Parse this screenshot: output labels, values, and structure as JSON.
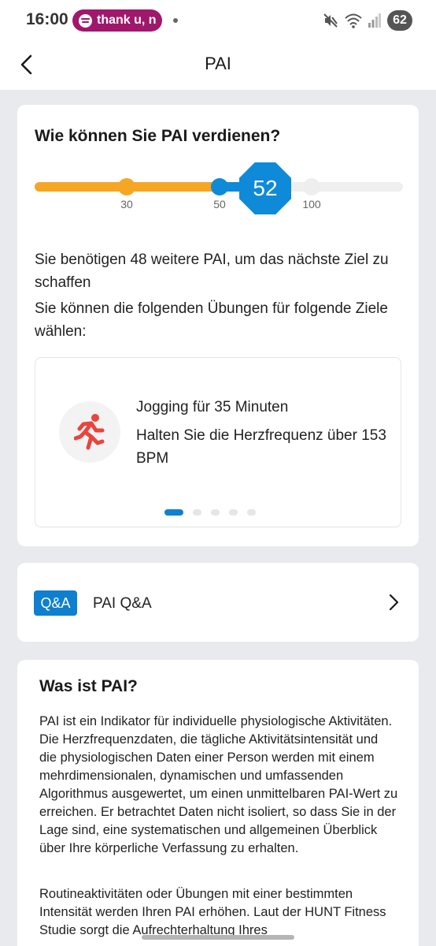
{
  "status_bar": {
    "time": "16:00",
    "media_title": "thank u, n",
    "battery": "62"
  },
  "header": {
    "title": "PAI"
  },
  "earn_card": {
    "title": "Wie können Sie PAI verdienen?",
    "progress": {
      "ticks": [
        "30",
        "50",
        "100"
      ],
      "current": "52",
      "value": 52,
      "max": 100
    },
    "needed_text": "Sie benötigen 48 weitere PAI, um das nächste Ziel zu schaffen",
    "choose_text": "Sie können die folgenden Übungen für folgende Ziele wählen:",
    "exercise": {
      "icon": "running-person-icon",
      "line1": "Jogging für 35 Minuten",
      "line2": "Halten Sie die Herzfrequenz über 153 BPM"
    },
    "carousel": {
      "total": 5,
      "active": 1
    }
  },
  "qa": {
    "badge": "Q&A",
    "label": "PAI Q&A"
  },
  "what_card": {
    "title": "Was ist PAI?",
    "paragraph1": "PAI ist ein Indikator für individuelle physiologische Aktivitäten. Die Herzfrequenzdaten, die tägliche Aktivitätsintensität und die physiologischen Daten einer Person werden mit einem mehrdimensionalen, dynamischen und umfassenden Algorithmus ausgewertet, um einen unmittelbaren PAI-Wert zu erreichen. Er betrachtet Daten nicht isoliert, so dass Sie in der Lage sind, eine systematischen und allgemeinen Überblick über Ihre körperliche Verfassung zu erhalten.",
    "paragraph2": "Routineaktivitäten oder Übungen mit einer bestimmten Intensität werden Ihren PAI erhöhen. Laut der HUNT Fitness Studie sorgt die Aufrechterhaltung Ihres"
  },
  "colors": {
    "accent_blue": "#0f8ad8",
    "orange": "#f5a623",
    "run_icon": "#e8453c",
    "media_pill": "#a0186b"
  }
}
